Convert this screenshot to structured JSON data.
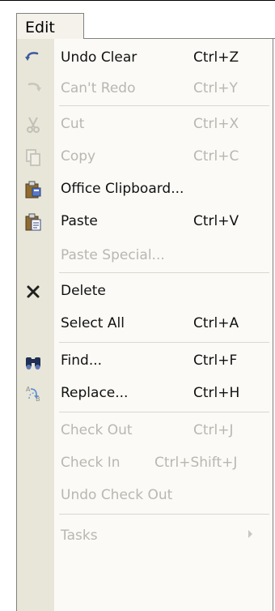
{
  "menu_bar": {
    "edit_label": "Edit"
  },
  "menu_items": [
    {
      "label": "Undo Clear",
      "shortcut": "Ctrl+Z",
      "enabled": true,
      "icon": "undo-icon"
    },
    {
      "label": "Can't Redo",
      "shortcut": "Ctrl+Y",
      "enabled": false,
      "icon": "redo-icon"
    },
    {
      "label": "Cut",
      "shortcut": "Ctrl+X",
      "enabled": false,
      "icon": "scissors-icon"
    },
    {
      "label": "Copy",
      "shortcut": "Ctrl+C",
      "enabled": false,
      "icon": "copy-icon"
    },
    {
      "label": "Office Clipboard...",
      "shortcut": "",
      "enabled": true,
      "icon": "office-clipboard-icon"
    },
    {
      "label": "Paste",
      "shortcut": "Ctrl+V",
      "enabled": true,
      "icon": "paste-icon"
    },
    {
      "label": "Paste Special...",
      "shortcut": "",
      "enabled": false,
      "icon": ""
    },
    {
      "label": "Delete",
      "shortcut": "",
      "enabled": true,
      "icon": "delete-x-icon"
    },
    {
      "label": "Select All",
      "shortcut": "Ctrl+A",
      "enabled": true,
      "icon": ""
    },
    {
      "label": "Find...",
      "shortcut": "Ctrl+F",
      "enabled": true,
      "icon": "binoculars-icon"
    },
    {
      "label": "Replace...",
      "shortcut": "Ctrl+H",
      "enabled": true,
      "icon": "replace-icon"
    },
    {
      "label": "Check Out",
      "shortcut": "Ctrl+J",
      "enabled": false,
      "icon": ""
    },
    {
      "label": "Check In",
      "shortcut": "Ctrl+Shift+J",
      "enabled": false,
      "icon": ""
    },
    {
      "label": "Undo Check Out",
      "shortcut": "",
      "enabled": false,
      "icon": ""
    },
    {
      "label": "Tasks",
      "shortcut": "",
      "enabled": false,
      "icon": ""
    }
  ],
  "colors": {
    "menu_background": "#fbfaf6",
    "icon_gutter": "#e8e6d8",
    "disabled_text": "#b8b7b1",
    "border": "#808080"
  }
}
